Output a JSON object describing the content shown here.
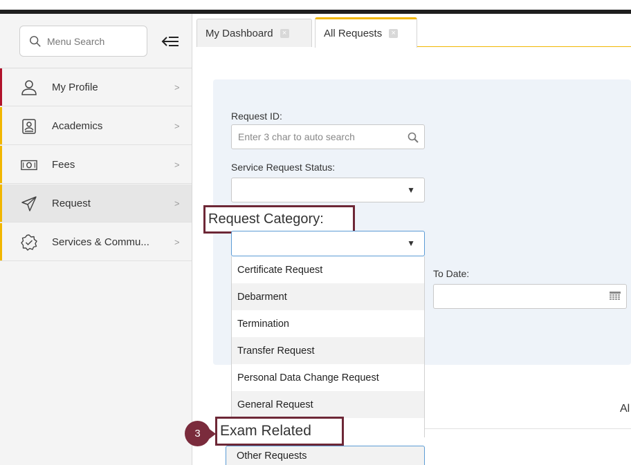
{
  "sidebar": {
    "search_placeholder": "Menu Search",
    "items": [
      {
        "label": "My Profile",
        "icon": "user-icon"
      },
      {
        "label": "Academics",
        "icon": "id-card-icon"
      },
      {
        "label": "Fees",
        "icon": "money-icon"
      },
      {
        "label": "Request",
        "icon": "paper-plane-icon"
      },
      {
        "label": "Services & Commu...",
        "icon": "services-badge-icon"
      }
    ],
    "chevron": ">"
  },
  "tabs": [
    {
      "label": "My Dashboard",
      "active": false
    },
    {
      "label": "All Requests",
      "active": true
    }
  ],
  "form": {
    "request_id_label": "Request ID:",
    "request_id_placeholder": "Enter 3 char to auto search",
    "status_label": "Service Request Status:",
    "category_label": "Request Category:",
    "to_date_label": "To Date:"
  },
  "category_options": [
    "Certificate Request",
    "Debarment",
    "Termination",
    "Transfer Request",
    "Personal Data Change Request",
    "General Request",
    "Other Requests"
  ],
  "annotation": {
    "step_number": "3",
    "callout_text": "Exam Related"
  },
  "partial_label": "Al",
  "colors": {
    "accent": "#f1b600",
    "profile_bar": "#b1122b",
    "callout_border": "#6d2736",
    "badge": "#7a2b3c",
    "panel_bg": "#eef3f9"
  }
}
